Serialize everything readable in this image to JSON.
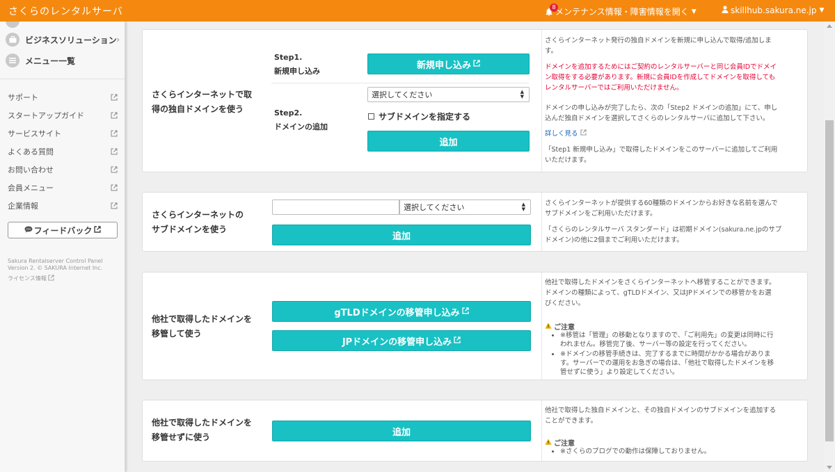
{
  "header": {
    "brand": "さくらのレンタルサーバ",
    "maintenance_link": "メンテナンス情報・障害情報を開く",
    "notification_count": "8",
    "user": "skillhub.sakura.ne.jp"
  },
  "sidebar": {
    "menu": [
      {
        "label": "ビジネスソリューション"
      },
      {
        "label": "メニュー一覧"
      }
    ],
    "links": [
      "サポート",
      "スタートアップガイド",
      "サービスサイト",
      "よくある質問",
      "お問い合わせ",
      "会員メニュー",
      "企業情報"
    ],
    "feedback": "フィードバック",
    "footer_line1": "Sakura Rentalserver Control Panel",
    "footer_line2": "Version 2. © SAKURA Internet Inc.",
    "license": "ライセンス情報"
  },
  "panel1": {
    "title_line1": "さくらインターネットで取",
    "title_line2": "得の独自ドメインを使う",
    "step1_line1": "Step1.",
    "step1_line2": "新規申し込み",
    "step1_button": "新規申し込み",
    "step2_line1": "Step2.",
    "step2_line2": "ドメインの追加",
    "select_value": "選択してください",
    "checkbox_label": "サブドメインを指定する",
    "add_button": "追加",
    "desc1_line1": "さくらインターネット発行の独自ドメインを新規に申し込んで取得/追加しま",
    "desc1_line2": "す。",
    "warn_line1": "ドメインを追加するためにはご契約のレンタルサーバーと同じ会員IDでドメイ",
    "warn_line2": "ン取得をする必要があります。新規に会員IDを作成してドメインを取得しても",
    "warn_line3": "レンタルサーバーではご利用いただけません。",
    "desc2_line1": "ドメインの申し込みが完了したら、次の「Step2 ドメインの追加」にて、申し",
    "desc2_line2": "込んだ独自ドメインを選択してさくらのレンタルサーバに追加して下さい。",
    "more_link": "詳しく見る",
    "desc3_line1": "「Step1 新規申し込み」で取得したドメインをこのサーバーに追加してご利用",
    "desc3_line2": "いただけます。"
  },
  "panel2": {
    "title_line1": "さくらインターネットの",
    "title_line2": "サブドメインを使う",
    "input_value": "",
    "select_value": "選択してください",
    "add_button": "追加",
    "desc1_line1": "さくらインターネットが提供する60種類のドメインからお好きな名前を選んで",
    "desc1_line2": "サブドメインをご利用いただけます。",
    "desc2_line1": "「さくらのレンタルサーバ スタンダード」は初期ドメイン(sakura.ne.jpのサブ",
    "desc2_line2": "ドメイン)の他に2個までご利用いただけます。"
  },
  "panel3": {
    "title_line1": "他社で取得したドメインを",
    "title_line2": "移管して使う",
    "gtld_button": "gTLDドメインの移管申し込み",
    "jp_button": "JPドメインの移管申し込み",
    "desc_line1": "他社で取得したドメインをさくらインターネットへ移管することができます。",
    "desc_line2": "ドメインの種類によって、gTLDドメイン、又はJPドメインでの移管かをお選",
    "desc_line3": "びください。",
    "warn_title": "ご注意",
    "notes": [
      [
        "※移管は「管理」の移動となりますので、「ご利用先」の変更は同時に行",
        "われません。移管完了後、サーバー等の設定を行ってください。"
      ],
      [
        "※ドメインの移管手続きは、完了するまでに時間がかかる場合がありま",
        "す。サーバーでの運用をお急ぎの場合は、「他社で取得したドメインを移",
        "管せずに使う」より設定してください。"
      ]
    ]
  },
  "panel4": {
    "title_line1": "他社で取得したドメインを",
    "title_line2": "移管せずに使う",
    "add_button": "追加",
    "desc_line1": "他社で取得した独自ドメインと、その独自ドメインのサブドメインを追加する",
    "desc_line2": "ことができます。",
    "warn_title": "ご注意",
    "note": "※さくらのブログでの動作は保障しておりません。"
  },
  "colors": {
    "header": "#f5890f",
    "button": "#19c1c4",
    "warning": "#e60033",
    "link": "#1c64b8"
  }
}
